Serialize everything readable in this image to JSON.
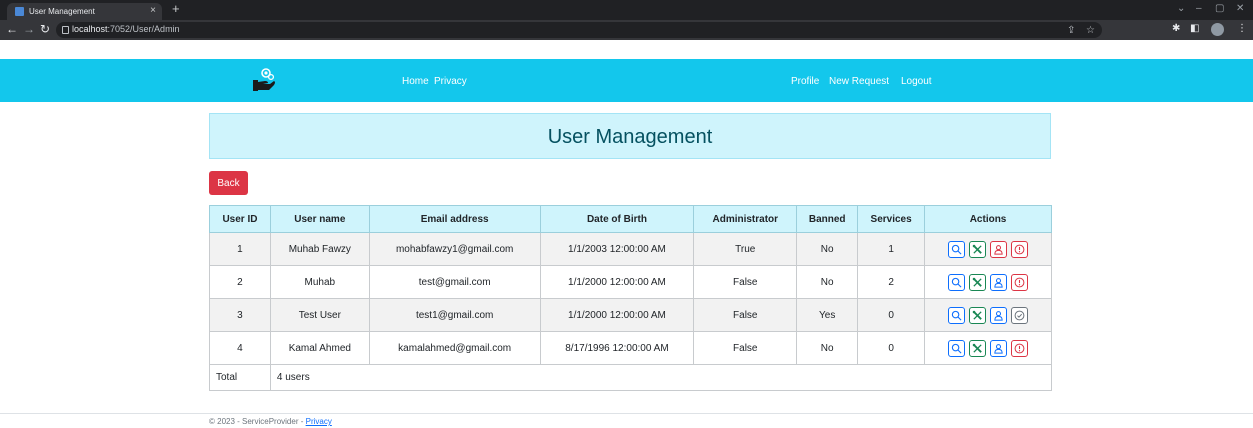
{
  "browser": {
    "tab_title": "User Management",
    "tab_close": "×",
    "new_tab": "+",
    "url_host": "localhost",
    "url_path": ":7052/User/Admin"
  },
  "navbar": {
    "links_left": [
      "Home",
      "Privacy"
    ],
    "links_right": [
      "Profile",
      "New Request",
      "Logout"
    ]
  },
  "page": {
    "title": "User Management",
    "back_label": "Back"
  },
  "table": {
    "headers": [
      "User ID",
      "User name",
      "Email address",
      "Date of Birth",
      "Administrator",
      "Banned",
      "Services",
      "Actions"
    ],
    "rows": [
      {
        "id": "1",
        "name": "Muhab Fawzy",
        "email": "mohabfawzy1@gmail.com",
        "dob": "1/1/2003 12:00:00 AM",
        "admin": "True",
        "banned": "No",
        "services": "1",
        "actions": [
          "search-icon",
          "tools-icon",
          "user-icon-red",
          "ban-icon"
        ]
      },
      {
        "id": "2",
        "name": "Muhab",
        "email": "test@gmail.com",
        "dob": "1/1/2000 12:00:00 AM",
        "admin": "False",
        "banned": "No",
        "services": "2",
        "actions": [
          "search-icon",
          "tools-icon",
          "user-icon-blue",
          "ban-icon"
        ]
      },
      {
        "id": "3",
        "name": "Test User",
        "email": "test1@gmail.com",
        "dob": "1/1/2000 12:00:00 AM",
        "admin": "False",
        "banned": "Yes",
        "services": "0",
        "actions": [
          "search-icon",
          "tools-icon",
          "user-icon-blue",
          "unban-check-icon"
        ]
      },
      {
        "id": "4",
        "name": "Kamal Ahmed",
        "email": "kamalahmed@gmail.com",
        "dob": "8/17/1996 12:00:00 AM",
        "admin": "False",
        "banned": "No",
        "services": "0",
        "actions": [
          "search-icon",
          "tools-icon",
          "user-icon-blue",
          "ban-icon"
        ]
      }
    ],
    "total_label": "Total",
    "total_value": "4 users"
  },
  "footer": {
    "text": "© 2023 - ServiceProvider - ",
    "link": "Privacy"
  },
  "colors": {
    "navbar": "#13c7ec",
    "header_bg": "#cff4fc",
    "title": "#055160",
    "danger": "#dc3545",
    "primary": "#0d6efd",
    "success": "#198754",
    "secondary": "#6c757d"
  }
}
